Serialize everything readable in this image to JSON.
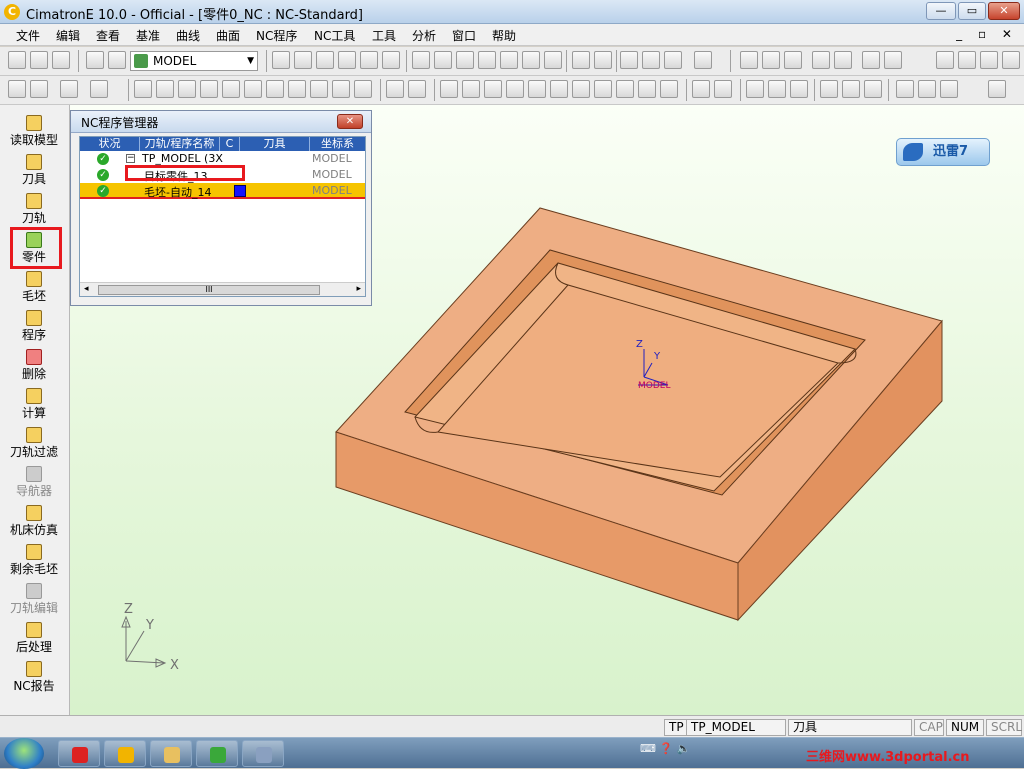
{
  "window": {
    "title": "CimatronE 10.0 - Official - [零件0_NC : NC-Standard]",
    "logo": "C"
  },
  "window_controls": {
    "minimize": "—",
    "maximize": "▭",
    "close": "✕"
  },
  "mdi_controls": "_ ▫ ✕",
  "menu": [
    "文件",
    "编辑",
    "查看",
    "基准",
    "曲线",
    "曲面",
    "NC程序",
    "NC工具",
    "工具",
    "分析",
    "窗口",
    "帮助"
  ],
  "toolbar": {
    "model_select": "MODEL"
  },
  "sidebar": {
    "items": [
      {
        "label": "读取模型",
        "enabled": true
      },
      {
        "label": "刀具",
        "enabled": true
      },
      {
        "label": "刀轨",
        "enabled": true
      },
      {
        "label": "零件",
        "enabled": true,
        "highlighted": true
      },
      {
        "label": "毛坯",
        "enabled": true
      },
      {
        "label": "程序",
        "enabled": true
      },
      {
        "label": "删除",
        "enabled": true
      },
      {
        "label": "计算",
        "enabled": true
      },
      {
        "label": "刀轨过滤",
        "enabled": true
      },
      {
        "label": "导航器",
        "enabled": false
      },
      {
        "label": "机床仿真",
        "enabled": true
      },
      {
        "label": "剩余毛坯",
        "enabled": true
      },
      {
        "label": "刀轨编辑",
        "enabled": false
      },
      {
        "label": "后处理",
        "enabled": true
      },
      {
        "label": "NC报告",
        "enabled": true
      }
    ]
  },
  "nc_manager": {
    "title": "NC程序管理器",
    "close": "✕",
    "columns": [
      "状况",
      "刀轨/程序名称",
      "C",
      "刀具",
      "坐标系"
    ],
    "rows": [
      {
        "status": "ok",
        "expander": "−",
        "name": "TP_MODEL (3X",
        "coord": "MODEL"
      },
      {
        "status": "ok",
        "name": "目标零件_13",
        "coord": "MODEL"
      },
      {
        "status": "ok",
        "name": "毛坯-自动_14",
        "coord": "MODEL",
        "selected": true
      }
    ],
    "scroll": {
      "left": "◂",
      "thumb": "III",
      "right": "▸"
    }
  },
  "viewport": {
    "ucs": {
      "z": "Z",
      "y": "Y",
      "label": "MODEL"
    },
    "axes": {
      "x": "X",
      "y": "Y",
      "z": "Z"
    },
    "badge": "迅雷7"
  },
  "status": {
    "tp": "TP",
    "tp_name": "TP_MODEL",
    "tool": "刀具",
    "cap": "CAP",
    "num": "NUM",
    "scrl": "SCRL"
  },
  "taskbar": {
    "tray_icons": "⌨ ❓ 🔈"
  },
  "watermark": "三维网www.3dportal.cn",
  "colors": {
    "part_top": "#eeae84",
    "part_front": "#e79a68",
    "part_right": "#e2925f",
    "highlight": "#e8191e",
    "selected_row": "#f6c400",
    "viewport_bg": "#e6f7dc"
  }
}
